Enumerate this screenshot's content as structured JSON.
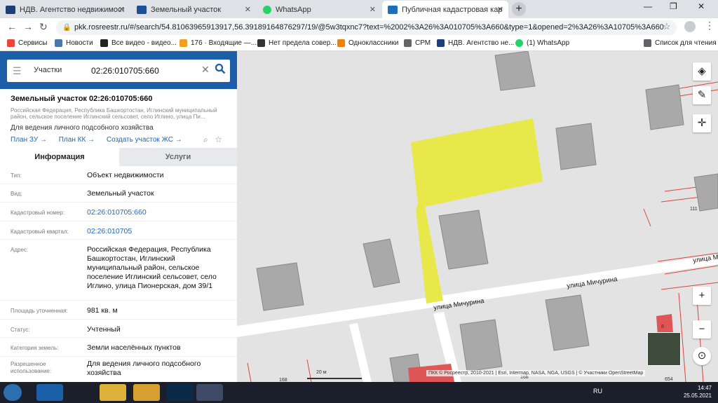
{
  "browser": {
    "tabs": [
      {
        "title": "НДВ. Агентство недвижимости.",
        "favicon_color": "#1c3f7a"
      },
      {
        "title": "Земельный участок",
        "favicon_color": "#1c4f9a"
      },
      {
        "title": "WhatsApp",
        "favicon_color": "#25d366"
      },
      {
        "title": "Публичная кадастровая карта",
        "favicon_color": "#1c6fb8"
      }
    ],
    "url": "pkk.rosreestr.ru/#/search/54.81063965913917,56.39189164876297/19/@5w3tqxnc7?text=%2002%3A26%3A010705%3A660&type=1&opened=2%3A26%3A10705%3A660",
    "bookmarks": [
      {
        "label": "Сервисы",
        "icon_color": "#e8453c"
      },
      {
        "label": "Новости",
        "icon_color": "#4a76a8"
      },
      {
        "label": "Все видео - видео...",
        "icon_color": "#222222"
      },
      {
        "label": "176 · Входящие —...",
        "icon_color": "#f0a020"
      },
      {
        "label": "Нет предела совер...",
        "icon_color": "#333333"
      },
      {
        "label": "Одноклассники",
        "icon_color": "#ee8208"
      },
      {
        "label": "СРМ",
        "icon_color": "#666666"
      },
      {
        "label": "НДВ. Агентство не...",
        "icon_color": "#1c3f7a"
      },
      {
        "label": "(1) WhatsApp",
        "icon_color": "#25d366"
      }
    ],
    "reading_list": "Список для чтения"
  },
  "search": {
    "type": "Участки",
    "query": "02:26:010705:660"
  },
  "object": {
    "title": "Земельный участок 02:26:010705:660",
    "address_short": "Российская Федерация, Республика Башкортостан, Иглинский муниципальный район, сельское поселение Иглинский сельсовет, село Иглино, улица Пи...",
    "purpose": "Для ведения личного подсобного хозяйства",
    "links": [
      "План ЗУ →",
      "План КК →",
      "Создать участок ЖС →"
    ],
    "tabs": [
      "Информация",
      "Услуги"
    ],
    "fields": [
      {
        "key": "Тип:",
        "value": "Объект недвижимости",
        "link": false
      },
      {
        "key": "Вид:",
        "value": "Земельный участок",
        "link": false
      },
      {
        "key": "Кадастровый номер:",
        "value": "02:26:010705:660",
        "link": true
      },
      {
        "key": "Кадастровый квартал:",
        "value": "02:26:010705",
        "link": true
      },
      {
        "key": "Адрес:",
        "value": "Российская Федерация, Республика Башкортостан, Иглинский муниципальный район, сельское поселение Иглинский сельсовет, село Иглино, улица Пионерская, дом 39/1",
        "link": false
      },
      {
        "key": "Площадь уточненная:",
        "value": "981 кв. м",
        "link": false
      },
      {
        "key": "Статус:",
        "value": "Учтенный",
        "link": false
      },
      {
        "key": "Категория земель:",
        "value": "Земли населённых пунктов",
        "link": false
      },
      {
        "key": "Разрешенное использование:",
        "value": "Для ведения личного подсобного хозяйства",
        "link": false
      }
    ]
  },
  "map": {
    "streets": [
      "улица Мичурина",
      "улица Мичурина",
      "улица Мичу"
    ],
    "parcel_numbers": [
      "111",
      "168",
      "168",
      "8",
      "654"
    ],
    "scale_label": "20 м",
    "attribution": "ПКК © Росреестр, 2010-2021 | Esri, Intermap, NASA, NGA, USGS | © Участники OpenStreetMap",
    "highlight_color": "#e8e84a"
  },
  "taskbar": {
    "lang": "RU",
    "time": "14:47",
    "date": "25.05.2021"
  }
}
